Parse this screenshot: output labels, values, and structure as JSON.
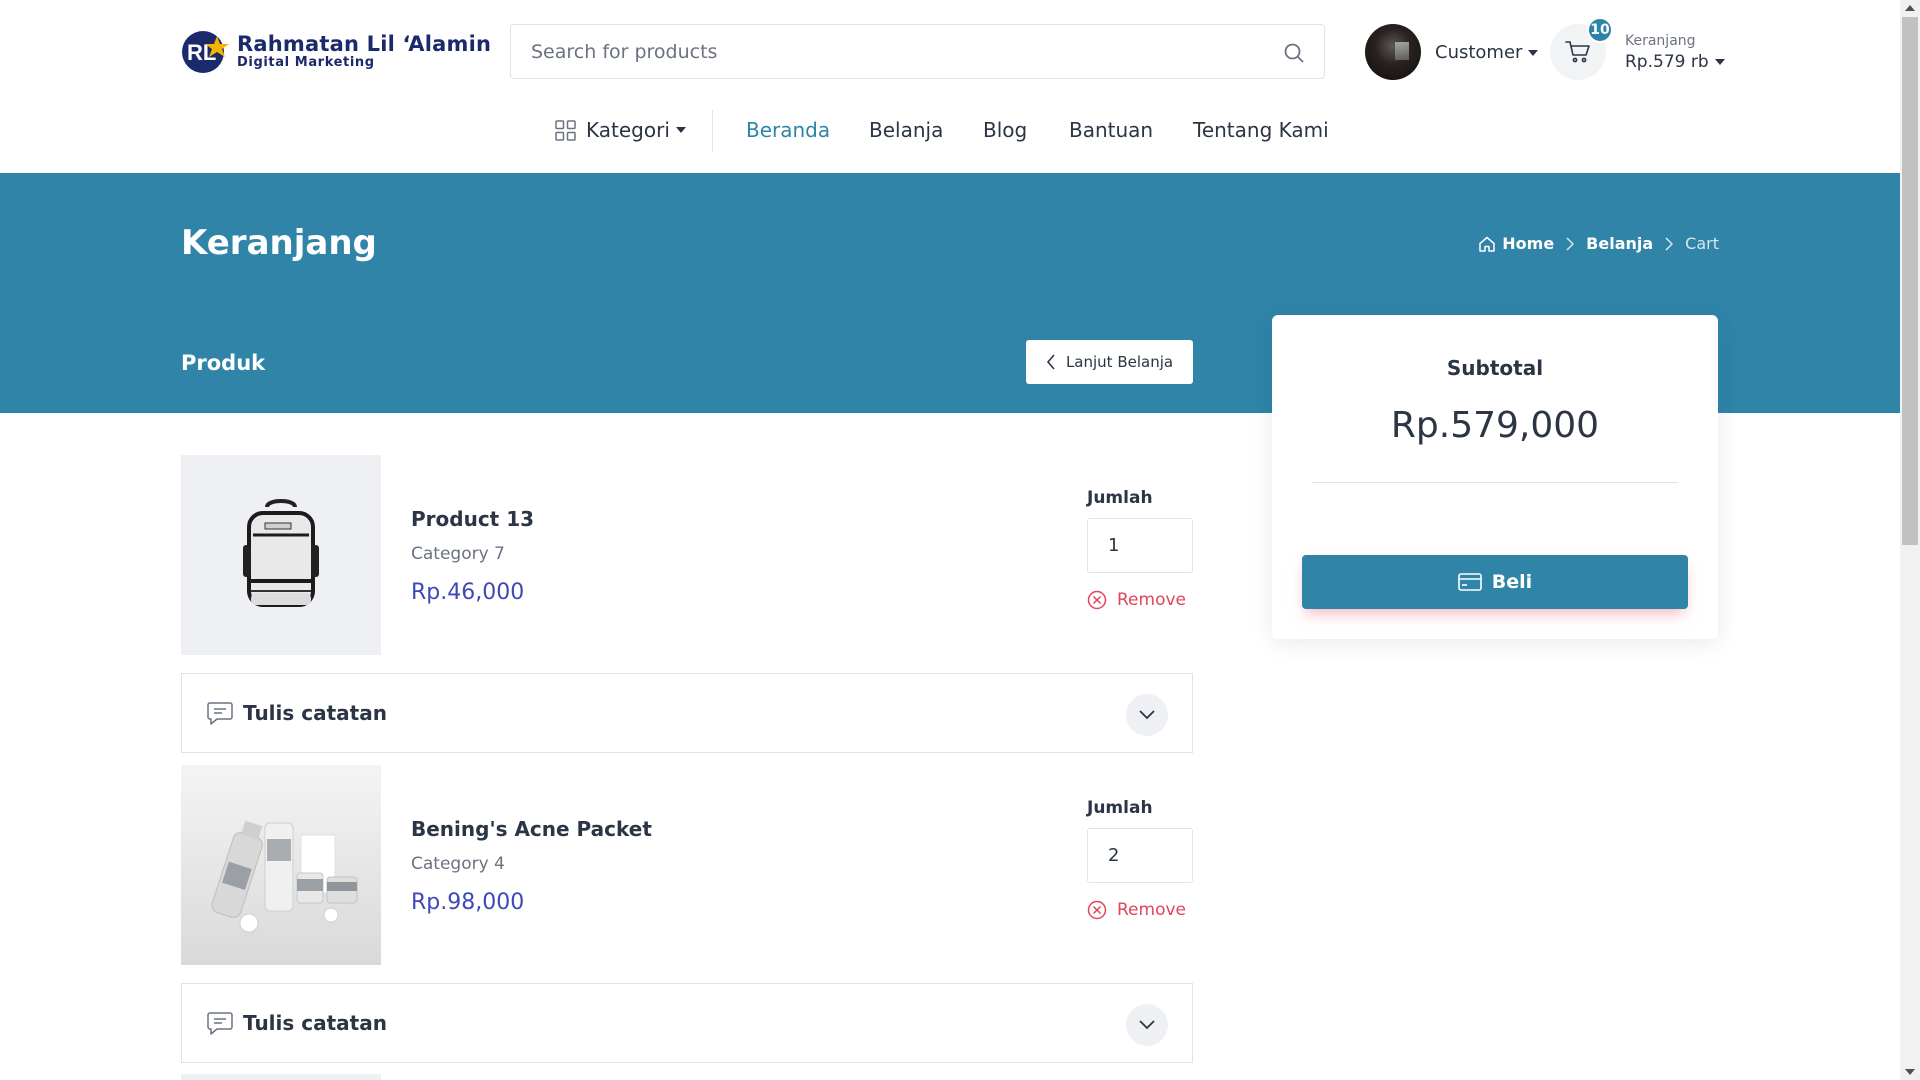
{
  "brand": {
    "title": "Rahmatan Lil ‘Alamin",
    "subtitle": "Digital Marketing",
    "mark_text": "RL",
    "colors": {
      "navy": "#1b2a6b",
      "gold": "#f4b400",
      "teal": "#2f84a8"
    }
  },
  "search": {
    "placeholder": "Search for products",
    "value": "",
    "icon": "search-icon"
  },
  "account": {
    "label": "Customer",
    "icon": "avatar"
  },
  "cart": {
    "badge_count": "10",
    "label": "Keranjang",
    "total": "Rp.579 rb",
    "icon": "cart-icon"
  },
  "nav": {
    "kategori_label": "Kategori",
    "items": [
      {
        "label": "Beranda",
        "active": true
      },
      {
        "label": "Belanja",
        "active": false
      },
      {
        "label": "Blog",
        "active": false
      },
      {
        "label": "Bantuan",
        "active": false
      },
      {
        "label": "Tentang Kami",
        "active": false
      }
    ]
  },
  "hero": {
    "title": "Keranjang",
    "breadcrumb": [
      {
        "label": "Home",
        "icon": "home-icon"
      },
      {
        "label": "Belanja"
      },
      {
        "label": "Cart"
      }
    ],
    "section_label": "Produk",
    "continue_button": "Lanjut Belanja",
    "background_color": "#2f84a8"
  },
  "cart_items": [
    {
      "name": "Product 13",
      "category": "Category 7",
      "price": "Rp.46,000",
      "quantity_label": "Jumlah",
      "quantity": "1",
      "remove_label": "Remove",
      "image": "backpack-image"
    },
    {
      "name": "Bening's Acne Packet",
      "category": "Category 4",
      "price": "Rp.98,000",
      "quantity_label": "Jumlah",
      "quantity": "2",
      "remove_label": "Remove",
      "image": "skincare-products-image"
    }
  ],
  "notes": [
    {
      "label": "Tulis catatan",
      "icon": "chat-icon"
    },
    {
      "label": "Tulis catatan",
      "icon": "chat-icon"
    }
  ],
  "summary": {
    "title": "Subtotal",
    "amount": "Rp.579,000",
    "buy_button": "Beli",
    "buy_icon": "credit-card-icon"
  },
  "colors": {
    "accent": "#2f84a8",
    "price": "#3d4ab5",
    "remove": "#e0455a",
    "text": "#2b3545"
  }
}
